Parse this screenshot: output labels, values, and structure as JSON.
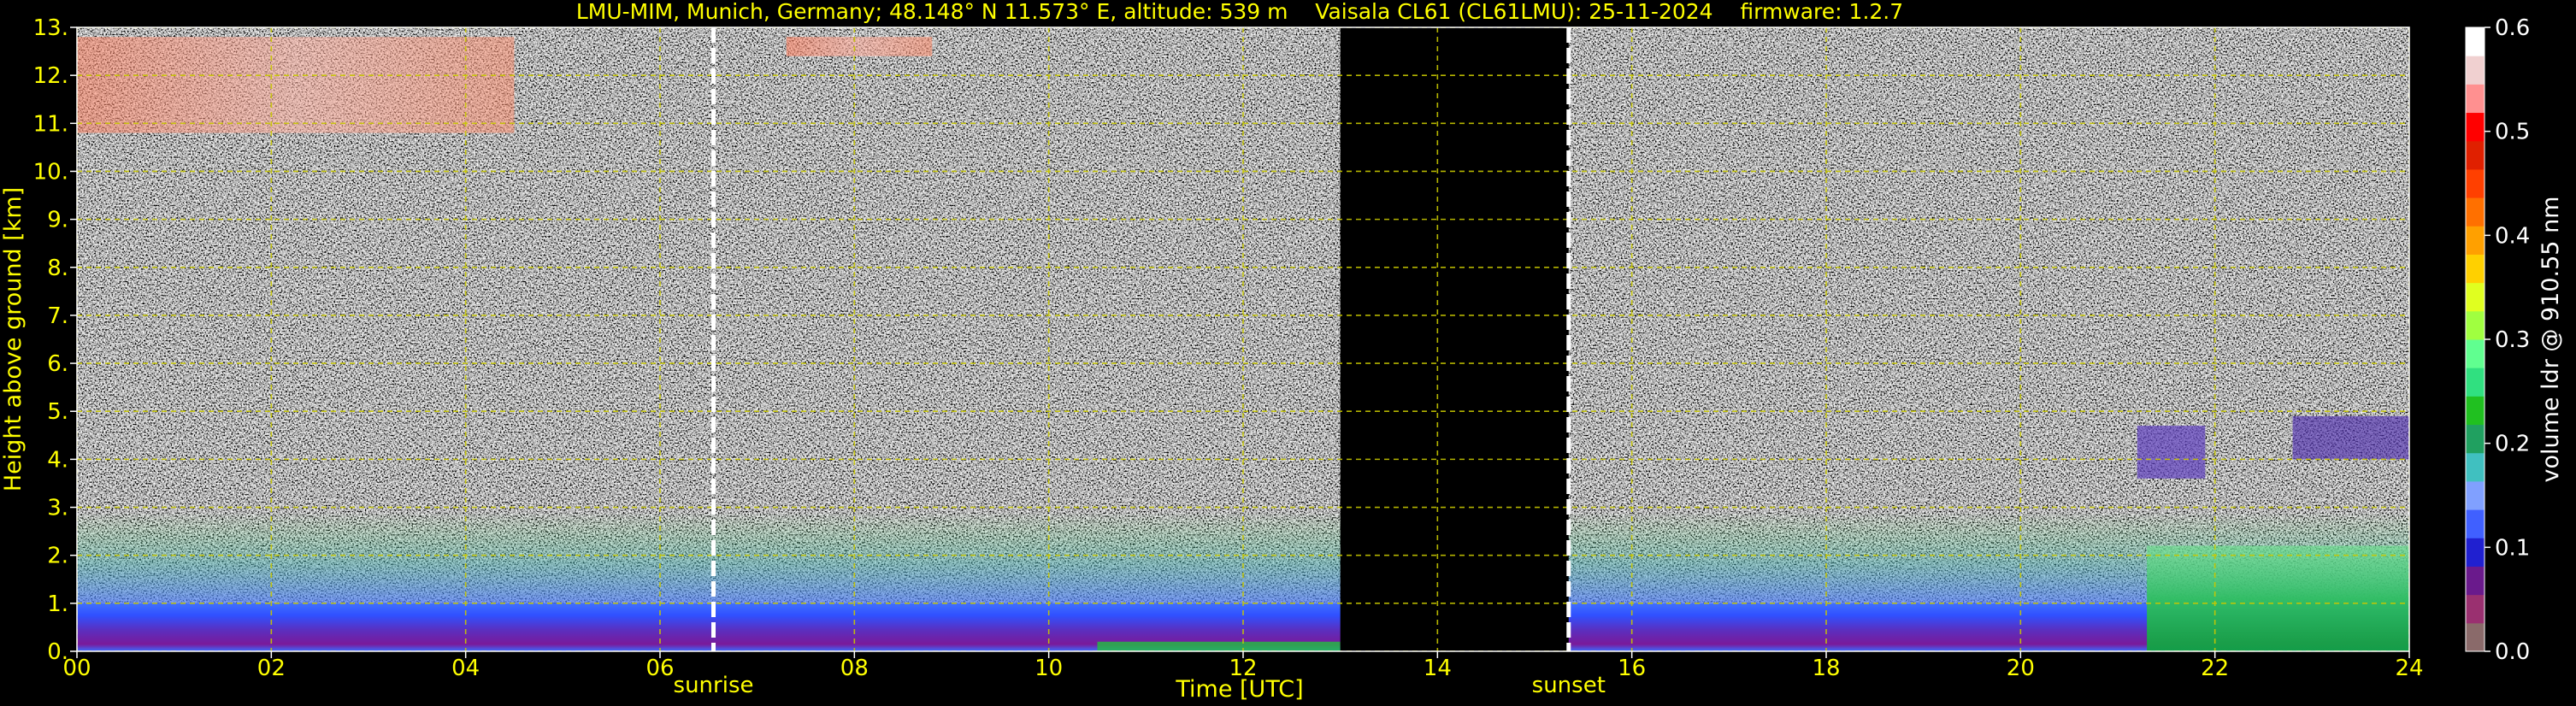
{
  "chart_data": {
    "type": "heatmap",
    "title": "LMU-MIM, Munich, Germany; 48.148° N 11.573° E, altitude: 539 m    Vaisala CL61 (CL61LMU): 25-11-2024    firmware: 1.2.7",
    "xlabel": "Time [UTC]",
    "ylabel": "Height above ground [km]",
    "xlim": [
      0,
      24
    ],
    "ylim": [
      0,
      13
    ],
    "x_ticks": [
      {
        "value": 0,
        "label": "00"
      },
      {
        "value": 2,
        "label": "02"
      },
      {
        "value": 4,
        "label": "04"
      },
      {
        "value": 6,
        "label": "06"
      },
      {
        "value": 8,
        "label": "08"
      },
      {
        "value": 10,
        "label": "10"
      },
      {
        "value": 12,
        "label": "12"
      },
      {
        "value": 14,
        "label": "14"
      },
      {
        "value": 16,
        "label": "16"
      },
      {
        "value": 18,
        "label": "18"
      },
      {
        "value": 20,
        "label": "20"
      },
      {
        "value": 22,
        "label": "22"
      },
      {
        "value": 24,
        "label": "24"
      }
    ],
    "y_ticks": [
      {
        "value": 0,
        "label": "0."
      },
      {
        "value": 1,
        "label": "1."
      },
      {
        "value": 2,
        "label": "2."
      },
      {
        "value": 3,
        "label": "3."
      },
      {
        "value": 4,
        "label": "4."
      },
      {
        "value": 5,
        "label": "5."
      },
      {
        "value": 6,
        "label": "6."
      },
      {
        "value": 7,
        "label": "7."
      },
      {
        "value": 8,
        "label": "8."
      },
      {
        "value": 9,
        "label": "9."
      },
      {
        "value": 10,
        "label": "10."
      },
      {
        "value": 11,
        "label": "11."
      },
      {
        "value": 12,
        "label": "12."
      },
      {
        "value": 13,
        "label": "13."
      }
    ],
    "grid": true,
    "data_gaps": [
      {
        "x_start": 13.0,
        "x_end": 15.35
      }
    ],
    "annotations": [
      {
        "label": "sunrise",
        "x": 6.55
      },
      {
        "label": "sunset",
        "x": 15.35
      }
    ],
    "features": [
      {
        "name": "boundary_layer",
        "x_start": 0.0,
        "x_end": 24.0,
        "y_min": 0.0,
        "y_max": 1.0
      },
      {
        "name": "aerosol_layer_low",
        "x_start": 0.0,
        "x_end": 24.0,
        "y_min": 1.0,
        "y_max": 2.9
      },
      {
        "name": "cirrus",
        "x_start": 0.0,
        "x_end": 4.5,
        "y_min": 10.8,
        "y_max": 12.8
      },
      {
        "name": "cirrus_patch",
        "x_start": 7.3,
        "x_end": 8.8,
        "y_min": 12.4,
        "y_max": 12.8
      },
      {
        "name": "green_layer_evening",
        "x_start": 21.3,
        "x_end": 24.0,
        "y_min": 0.0,
        "y_max": 2.2
      },
      {
        "name": "mid_level_patch_1",
        "x_start": 21.2,
        "x_end": 21.9,
        "y_min": 3.6,
        "y_max": 4.7
      },
      {
        "name": "mid_level_patch_2",
        "x_start": 22.8,
        "x_end": 24.0,
        "y_min": 4.0,
        "y_max": 4.9
      }
    ],
    "colorbar": {
      "label": "volume ldr @ 910.55 nm",
      "range": [
        0.0,
        0.6
      ],
      "ticks": [
        {
          "value": 0.0,
          "label": "0.0"
        },
        {
          "value": 0.1,
          "label": "0.1"
        },
        {
          "value": 0.2,
          "label": "0.2"
        },
        {
          "value": 0.3,
          "label": "0.3"
        },
        {
          "value": 0.4,
          "label": "0.4"
        },
        {
          "value": 0.5,
          "label": "0.5"
        },
        {
          "value": 0.6,
          "label": "0.6"
        }
      ],
      "colors": [
        "#8a6a6a",
        "#9a3070",
        "#6a1a8c",
        "#2020d0",
        "#4060ff",
        "#80a0ff",
        "#40c0c0",
        "#20a060",
        "#20c020",
        "#30e080",
        "#60ff90",
        "#a0ff40",
        "#e0ff20",
        "#ffd000",
        "#ffa000",
        "#ff7000",
        "#ff4000",
        "#e02000",
        "#ff0000",
        "#ff9090",
        "#f0d0d0",
        "#ffffff"
      ]
    },
    "colors": {
      "text": "#ffff00",
      "grid": "#c8c800",
      "background": "#000000"
    }
  }
}
